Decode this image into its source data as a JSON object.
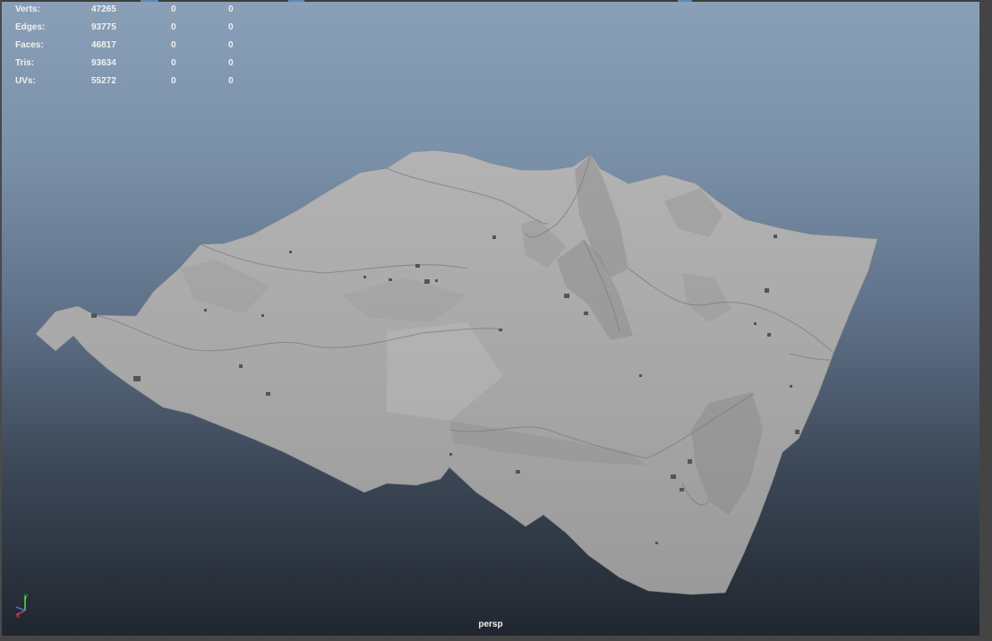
{
  "hud": {
    "rows": [
      {
        "label": "Verts:",
        "total": "47265",
        "selected": "0",
        "uv_selected": "0"
      },
      {
        "label": "Edges:",
        "total": "93775",
        "selected": "0",
        "uv_selected": "0"
      },
      {
        "label": "Faces:",
        "total": "46817",
        "selected": "0",
        "uv_selected": "0"
      },
      {
        "label": "Tris:",
        "total": "93634",
        "selected": "0",
        "uv_selected": "0"
      },
      {
        "label": "UVs:",
        "total": "55272",
        "selected": "0",
        "uv_selected": "0"
      }
    ]
  },
  "viewport": {
    "camera_label": "persp",
    "gradient_top": "#8aa0b8",
    "gradient_bottom": "#20262e",
    "mesh_color": "#a8a8a8"
  },
  "axis_gizmo": {
    "y_label": "y",
    "x_label": "x",
    "y_color": "#4ee04e",
    "x_color": "#e04040",
    "z_color": "#4a6ae8"
  }
}
